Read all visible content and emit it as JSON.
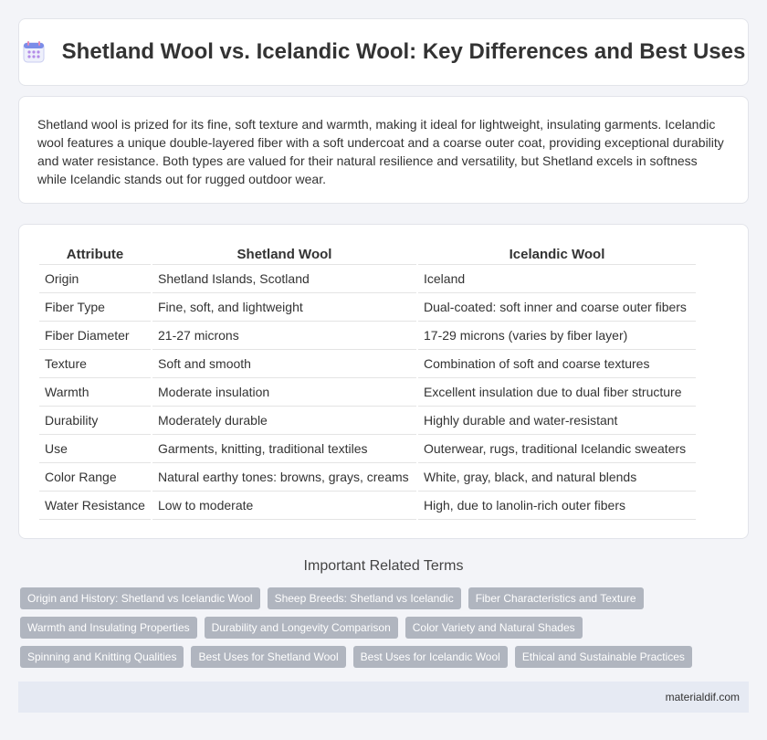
{
  "header": {
    "title": "Shetland Wool vs. Icelandic Wool: Key Differences and Best Uses",
    "icon": "calendar-grid-icon"
  },
  "intro": {
    "text": "Shetland wool is prized for its fine, soft texture and warmth, making it ideal for lightweight, insulating garments. Icelandic wool features a unique double-layered fiber with a soft undercoat and a coarse outer coat, providing exceptional durability and water resistance. Both types are valued for their natural resilience and versatility, but Shetland excels in softness while Icelandic stands out for rugged outdoor wear."
  },
  "table": {
    "headers": [
      "Attribute",
      "Shetland Wool",
      "Icelandic Wool"
    ],
    "rows": [
      [
        "Origin",
        "Shetland Islands, Scotland",
        "Iceland"
      ],
      [
        "Fiber Type",
        "Fine, soft, and lightweight",
        "Dual-coated: soft inner and coarse outer fibers"
      ],
      [
        "Fiber Diameter",
        "21-27 microns",
        "17-29 microns (varies by fiber layer)"
      ],
      [
        "Texture",
        "Soft and smooth",
        "Combination of soft and coarse textures"
      ],
      [
        "Warmth",
        "Moderate insulation",
        "Excellent insulation due to dual fiber structure"
      ],
      [
        "Durability",
        "Moderately durable",
        "Highly durable and water-resistant"
      ],
      [
        "Use",
        "Garments, knitting, traditional textiles",
        "Outerwear, rugs, traditional Icelandic sweaters"
      ],
      [
        "Color Range",
        "Natural earthy tones: browns, grays, creams",
        "White, gray, black, and natural blends"
      ],
      [
        "Water Resistance",
        "Low to moderate",
        "High, due to lanolin-rich outer fibers"
      ]
    ]
  },
  "related": {
    "title": "Important Related Terms",
    "tags": [
      "Origin and History: Shetland vs Icelandic Wool",
      "Sheep Breeds: Shetland vs Icelandic",
      "Fiber Characteristics and Texture",
      "Warmth and Insulating Properties",
      "Durability and Longevity Comparison",
      "Color Variety and Natural Shades",
      "Spinning and Knitting Qualities",
      "Best Uses for Shetland Wool",
      "Best Uses for Icelandic Wool",
      "Ethical and Sustainable Practices"
    ]
  },
  "footer": {
    "site": "materialdif.com"
  },
  "colors": {
    "tag_bg": "#b0b5bf",
    "footer_bg": "#e6eaf3",
    "page_bg": "#f3f4f8"
  }
}
